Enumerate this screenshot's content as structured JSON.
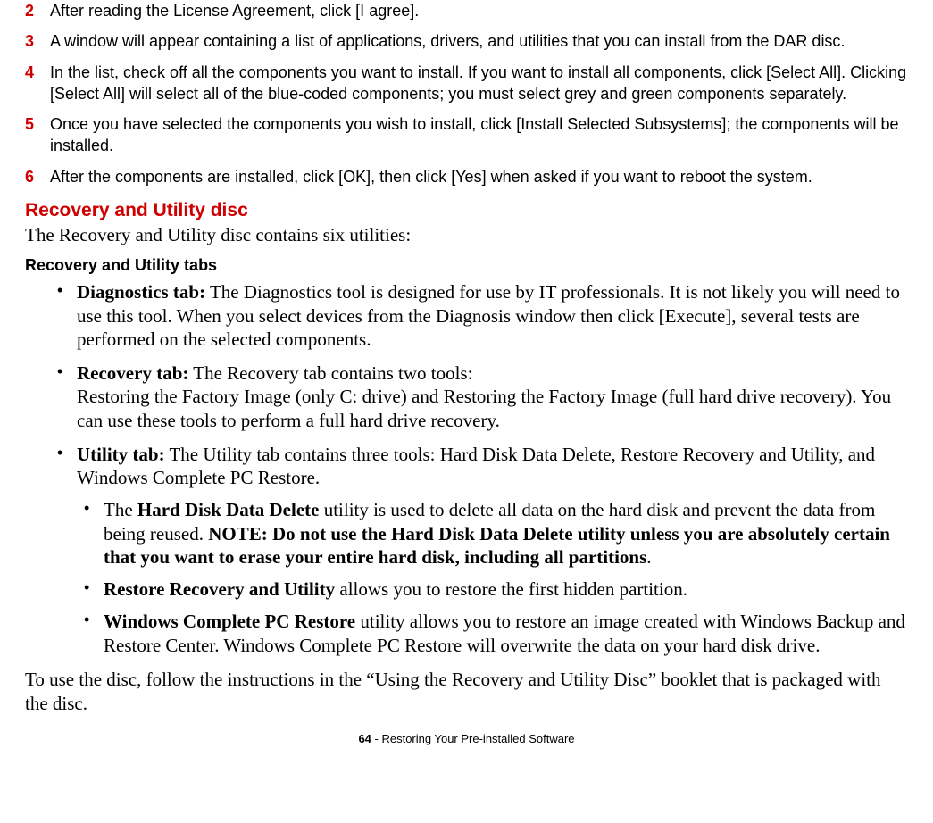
{
  "steps": [
    {
      "num": "2",
      "text": "After reading the License Agreement, click [I agree]."
    },
    {
      "num": "3",
      "text": "A window will appear containing a list of applications, drivers, and utilities that you can install from the DAR disc."
    },
    {
      "num": "4",
      "text": "In the list, check off all the components you want to install. If you want to install all components, click [Select All]. Clicking [Select All] will select all of the blue-coded components; you must select grey and green components separately."
    },
    {
      "num": "5",
      "text": "Once you have selected the components you wish to install, click [Install Selected Subsystems]; the components will be installed."
    },
    {
      "num": "6",
      "text": "After the components are installed, click [OK], then click [Yes] when asked if you want to reboot the system."
    }
  ],
  "recovery_heading": "Recovery and Utility disc",
  "recovery_intro": "The Recovery and Utility disc contains six utilities:",
  "tabs_heading": "Recovery and Utility tabs",
  "diag_label": "Diagnostics tab:",
  "diag_text": " The Diagnostics tool is designed for use by IT professionals. It is not likely you will need to use this tool. When you select devices from the Diagnosis window then click [Execute], several tests are performed on the selected components.",
  "rec_label": "Recovery tab:",
  "rec_text1": " The Recovery tab contains two tools:",
  "rec_text2": "Restoring the Factory Image (only C: drive) and Restoring the Factory Image (full hard drive recovery). You can use these tools to perform a full hard drive recovery.",
  "util_label": "Utility tab:",
  "util_text": " The Utility tab contains three tools: Hard Disk Data Delete, Restore Recovery and Utility, and Windows Complete PC Restore.",
  "sub1_pre": "The ",
  "sub1_bold1": "Hard Disk Data Delete",
  "sub1_mid": " utility is used to delete all data on the hard disk and prevent the data from being reused. ",
  "sub1_bold2": "NOTE: Do not use the Hard Disk Data Delete utility unless you are absolutely certain that you want to erase your entire hard disk, including all partitions",
  "sub1_post": ".",
  "sub2_bold": "Restore Recovery and Utility",
  "sub2_text": " allows you to restore the first hidden partition.",
  "sub3_bold": "Windows Complete PC Restore",
  "sub3_text": " utility allows you to restore an image created with Windows Backup and Restore Center. Windows Complete PC Restore will overwrite the data on your hard disk drive.",
  "closing": "To use the disc, follow the instructions in the “Using the Recovery and Utility Disc” booklet that is pack­aged with the disc.",
  "footer_page": "64",
  "footer_title": " - Restoring Your Pre-installed Software"
}
